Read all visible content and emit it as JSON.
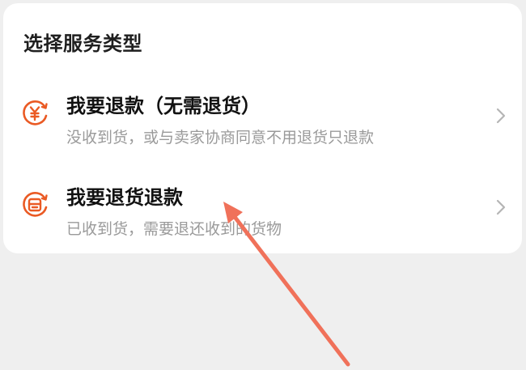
{
  "header": {
    "title": "选择服务类型"
  },
  "options": [
    {
      "title": "我要退款（无需退货）",
      "subtitle": "没收到货，或与卖家协商同意不用退货只退款",
      "icon": "yuan-refund-icon"
    },
    {
      "title": "我要退货退款",
      "subtitle": "已收到货，需要退还收到的货物",
      "icon": "return-package-icon"
    }
  ],
  "colors": {
    "accent": "#ea5a24",
    "annotation_arrow": "#f0715a"
  }
}
